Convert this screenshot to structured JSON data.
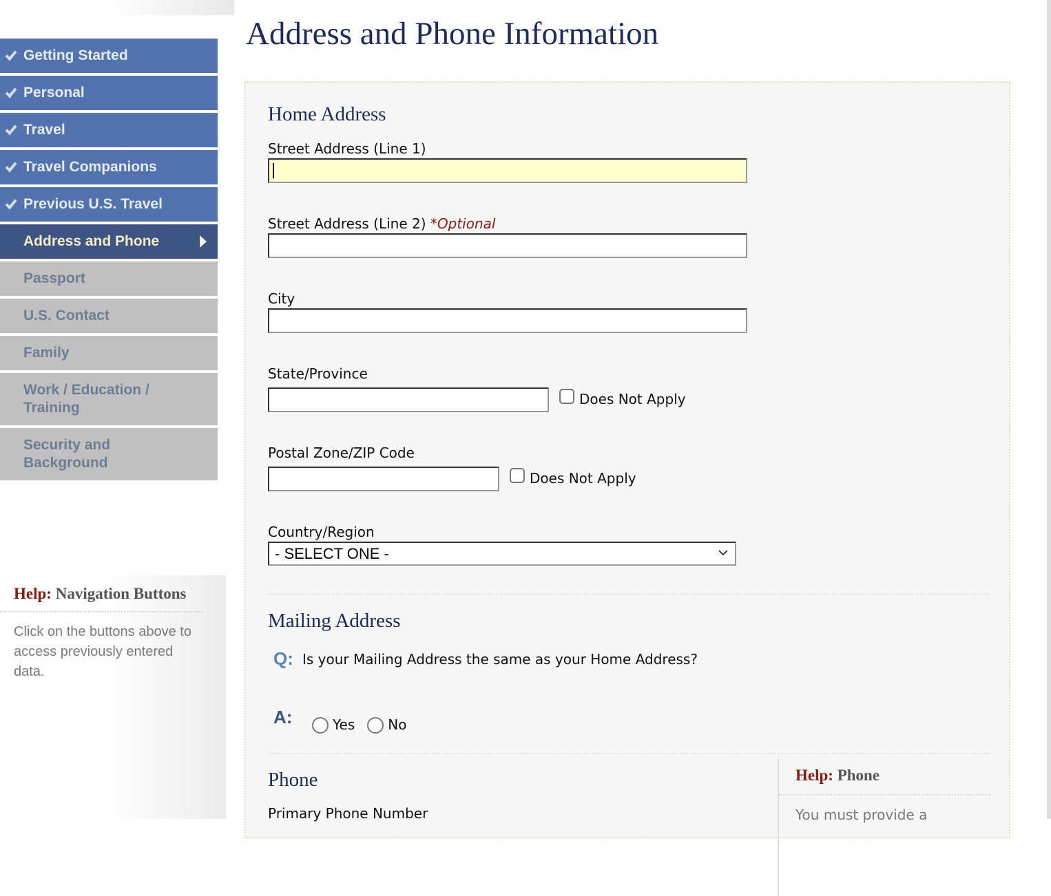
{
  "page": {
    "title": "Address and Phone Information"
  },
  "sidebar": {
    "items": [
      {
        "label": "Getting Started",
        "state": "done"
      },
      {
        "label": "Personal",
        "state": "done"
      },
      {
        "label": "Travel",
        "state": "done"
      },
      {
        "label": "Travel Companions",
        "state": "done"
      },
      {
        "label": "Previous U.S. Travel",
        "state": "done"
      },
      {
        "label": "Address and Phone",
        "state": "current"
      },
      {
        "label": "Passport",
        "state": "pending"
      },
      {
        "label": "U.S. Contact",
        "state": "pending"
      },
      {
        "label": "Family",
        "state": "pending"
      },
      {
        "label": "Work / Education / Training",
        "state": "pending"
      },
      {
        "label": "Security and Background",
        "state": "pending"
      }
    ],
    "help": {
      "label": "Help:",
      "topic": "Navigation Buttons",
      "text": "Click on the buttons above to access previously entered data."
    }
  },
  "home_address": {
    "title": "Home Address",
    "street1": {
      "label": "Street Address (Line 1)",
      "value": ""
    },
    "street2": {
      "label": "Street Address (Line 2)",
      "optional": "*Optional",
      "value": ""
    },
    "city": {
      "label": "City",
      "value": ""
    },
    "state": {
      "label": "State/Province",
      "value": "",
      "does_not_apply": "Does Not Apply"
    },
    "postal": {
      "label": "Postal Zone/ZIP Code",
      "value": "",
      "does_not_apply": "Does Not Apply"
    },
    "country": {
      "label": "Country/Region",
      "selected": "- SELECT ONE -"
    }
  },
  "mailing_address": {
    "title": "Mailing Address",
    "q_label": "Q:",
    "question": "Is your Mailing Address the same as your Home Address?",
    "a_label": "A:",
    "options": [
      "Yes",
      "No"
    ]
  },
  "phone": {
    "title": "Phone",
    "primary_label": "Primary Phone Number",
    "help": {
      "label": "Help:",
      "topic": "Phone",
      "text": "You must provide a"
    }
  },
  "colors": {
    "nav_done": "#5373ae",
    "nav_current": "#3e5584",
    "nav_pending": "#c0c0c0",
    "title": "#1c2a5e",
    "help_label": "#8b1a0e",
    "focused_input": "#ffffcc"
  }
}
